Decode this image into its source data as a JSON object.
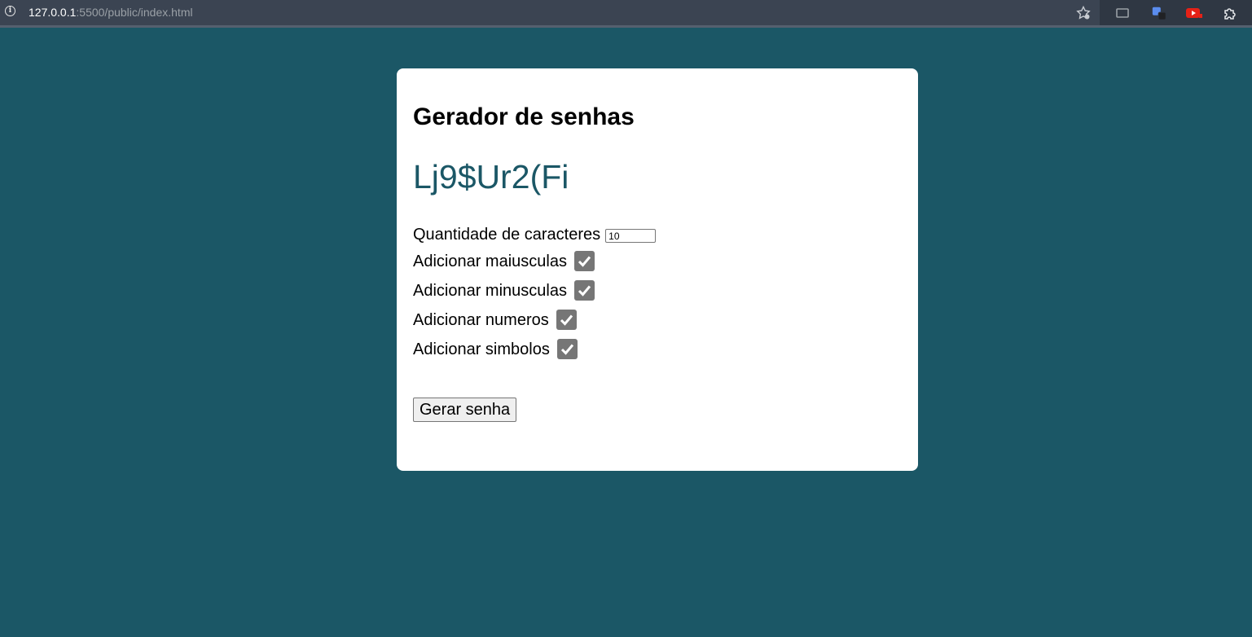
{
  "browser": {
    "url_host": "127.0.0.1",
    "url_path": ":5500/public/index.html"
  },
  "app": {
    "title": "Gerador de senhas",
    "password": "Lj9$Ur2(Fi",
    "quantity_label": "Quantidade de caracteres",
    "quantity_value": "10",
    "options": [
      {
        "label": "Adicionar maiusculas",
        "checked": true
      },
      {
        "label": "Adicionar minusculas",
        "checked": true
      },
      {
        "label": "Adicionar numeros",
        "checked": true
      },
      {
        "label": "Adicionar simbolos",
        "checked": true
      }
    ],
    "button_label": "Gerar senha"
  },
  "colors": {
    "background": "#1b5766",
    "password_text": "#1b5766",
    "card": "#ffffff",
    "checkbox": "#767676"
  },
  "icons": [
    "info-icon",
    "bookmark-star-icon",
    "screen-icon",
    "extension-tab-icon",
    "youtube-icon",
    "puzzle-icon",
    "checkmark-icon"
  ]
}
